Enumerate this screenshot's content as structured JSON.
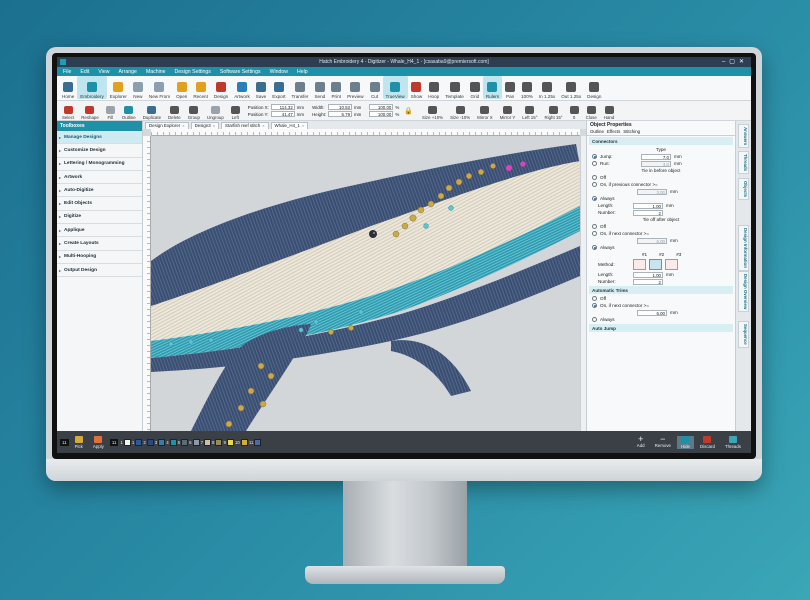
{
  "window": {
    "title": "Hatch Embroidery 4 - Digitizer - Whale_H4_1 - [csasaba9@premiersoft.com]"
  },
  "menu": [
    "File",
    "Edit",
    "View",
    "Arrange",
    "Machine",
    "Design Settings",
    "Software Settings",
    "Window",
    "Help"
  ],
  "ribbon": [
    {
      "label": "Home",
      "icon": "home-icon",
      "color": "#3a6d90"
    },
    {
      "label": "Embroidery",
      "icon": "embroidery-icon",
      "color": "#1e90a8"
    },
    {
      "label": "Explorer",
      "icon": "folder-icon",
      "color": "#e0a21e"
    },
    {
      "label": "New",
      "icon": "new-file-icon",
      "color": "#8aa0b0"
    },
    {
      "label": "New From",
      "icon": "new-from-icon",
      "color": "#8aa0b0"
    },
    {
      "label": "Open",
      "icon": "open-folder-icon",
      "color": "#e0a21e"
    },
    {
      "label": "Recent",
      "icon": "recent-icon",
      "color": "#e0a21e"
    },
    {
      "label": "Design",
      "icon": "design-icon",
      "color": "#c0392b"
    },
    {
      "label": "Artwork",
      "icon": "artwork-icon",
      "color": "#2980b9"
    },
    {
      "label": "Save",
      "icon": "save-icon",
      "color": "#3a6d90"
    },
    {
      "label": "Export",
      "icon": "export-icon",
      "color": "#3a6d90"
    },
    {
      "label": "Transfer",
      "icon": "transfer-icon",
      "color": "#6d7f8c"
    },
    {
      "label": "Send",
      "icon": "send-icon",
      "color": "#6d7f8c"
    },
    {
      "label": "Print",
      "icon": "print-icon",
      "color": "#6d7f8c"
    },
    {
      "label": "Preview",
      "icon": "preview-icon",
      "color": "#6d7f8c"
    },
    {
      "label": "Cut",
      "icon": "cut-icon",
      "color": "#6d7f8c"
    },
    {
      "label": "TrueView",
      "icon": "trueview-icon",
      "color": "#1e90a8"
    },
    {
      "label": "Show",
      "icon": "show-icon",
      "color": "#c0392b"
    },
    {
      "label": "Hoop",
      "icon": "hoop-icon",
      "color": "#555555"
    },
    {
      "label": "Template",
      "icon": "template-icon",
      "color": "#555555"
    },
    {
      "label": "Grid",
      "icon": "grid-icon",
      "color": "#555555"
    },
    {
      "label": "Rulers",
      "icon": "rulers-icon",
      "color": "#1e90a8"
    },
    {
      "label": "Pan",
      "icon": "pan-icon",
      "color": "#555555"
    },
    {
      "label": "100%",
      "icon": "zoom-100-icon",
      "color": "#555555"
    },
    {
      "label": "In 1.25x",
      "icon": "zoom-in-icon",
      "color": "#555555"
    },
    {
      "label": "Out 1.25x",
      "icon": "zoom-out-icon",
      "color": "#555555"
    },
    {
      "label": "Design",
      "icon": "zoom-design-icon",
      "color": "#555555"
    }
  ],
  "toolbar": {
    "tools": [
      {
        "label": "Select",
        "icon": "select-arrow-icon",
        "color": "#c0392b"
      },
      {
        "label": "Reshape",
        "icon": "reshape-icon",
        "color": "#c0392b"
      },
      {
        "label": "Fill",
        "icon": "fill-icon",
        "color": "#9aa3aa"
      },
      {
        "label": "Outline",
        "icon": "outline-icon",
        "color": "#1e90a8"
      },
      {
        "label": "Duplicate",
        "icon": "duplicate-icon",
        "color": "#3a6d90"
      },
      {
        "label": "Delete",
        "icon": "delete-icon",
        "color": "#555555"
      },
      {
        "label": "Group",
        "icon": "group-icon",
        "color": "#555555"
      },
      {
        "label": "Ungroup",
        "icon": "ungroup-icon",
        "color": "#9aa3aa"
      },
      {
        "label": "Left",
        "icon": "align-left-icon",
        "color": "#555555"
      }
    ],
    "position_x_label": "Position X:",
    "position_x": "114.32",
    "position_y_label": "Position Y:",
    "position_y": "41.47",
    "width_label": "Width:",
    "width": "10.53",
    "height_label": "Height:",
    "height": "5.79",
    "unit": "mm",
    "percent_w": "100.00",
    "percent_h": "100.00",
    "percent_unit": "%",
    "right_tools": [
      {
        "label": "Size +10%",
        "icon": "size-plus-icon",
        "color": "#555555"
      },
      {
        "label": "Size -10%",
        "icon": "size-minus-icon",
        "color": "#555555"
      },
      {
        "label": "Mirror X",
        "icon": "mirror-x-icon",
        "color": "#555555"
      },
      {
        "label": "Mirror Y",
        "icon": "mirror-y-icon",
        "color": "#555555"
      },
      {
        "label": "Left 15°",
        "icon": "rotate-left-icon",
        "color": "#555555"
      },
      {
        "label": "Right 15°",
        "icon": "rotate-right-icon",
        "color": "#555555"
      },
      {
        "label": "0",
        "icon": "angle-icon",
        "color": "#555555"
      },
      {
        "label": "Close",
        "icon": "close-shape-icon",
        "color": "#555555"
      },
      {
        "label": "Hand",
        "icon": "hand-icon",
        "color": "#555555"
      }
    ]
  },
  "toolboxes": {
    "title": "Toolboxes",
    "items": [
      "Manage Designs",
      "Customize Design",
      "Lettering / Monogramming",
      "Artwork",
      "Auto-Digitize",
      "Edit Objects",
      "Digitize",
      "Applique",
      "Create Layouts",
      "Multi-Hooping",
      "Output Design"
    ]
  },
  "doc_tabs": [
    "Design Explorer",
    "Design3",
    "Starfish reef stitch",
    "Whale_H4_1"
  ],
  "properties": {
    "title": "Object Properties",
    "tabs": [
      "Outline",
      "Effects",
      "Stitching"
    ],
    "connectors_title": "Connectors",
    "type_label": "Type",
    "jump_label": "Jump:",
    "jump_value": "7.0",
    "run_label": "Run:",
    "run_value": "3.0",
    "unit": "mm",
    "tie_in_title": "Tie in before object",
    "tie_in_off": "Off",
    "tie_in_prev": "On, if previous connector >=",
    "tie_in_prev_value": "3.00",
    "tie_in_always": "Always",
    "length_label": "Length:",
    "length_value": "1.00",
    "number_label": "Number:",
    "number_value": "2",
    "tie_off_title": "Tie off after object",
    "tie_off_off": "Off",
    "tie_off_next": "On, if next connector >=",
    "tie_off_next_value": "6.00",
    "tie_off_always": "Always",
    "method_label": "Method:",
    "method_1": "#1",
    "method_2": "#2",
    "method_3": "#3",
    "length2_value": "1.00",
    "number2_value": "2",
    "trims_title": "Automatic Trims",
    "trims_off": "Off",
    "trims_next": "On, if next connector >=",
    "trims_next_value": "6.00",
    "trims_always": "Always",
    "autojump_title": "Auto Jump"
  },
  "side_tabs": [
    "Answers",
    "Threads",
    "Objects",
    "Design Information",
    "Design Overview",
    "Sequence"
  ],
  "statusbar": {
    "thread_count": "11",
    "pick_label": "Pick",
    "apply_label": "Apply",
    "thread_badge": "11",
    "palette": [
      {
        "num": "1",
        "color": "#f5f5f0"
      },
      {
        "num": "1",
        "color": "#2a5a9a"
      },
      {
        "num": "2",
        "color": "#2a4a7a"
      },
      {
        "num": "3",
        "color": "#3a7ab0"
      },
      {
        "num": "4",
        "color": "#1e90a8"
      },
      {
        "num": "5",
        "color": "#5a6b7a"
      },
      {
        "num": "6",
        "color": "#8a9aa8"
      },
      {
        "num": "7",
        "color": "#c8c0a8"
      },
      {
        "num": "8",
        "color": "#9a8a5a"
      },
      {
        "num": "9",
        "color": "#e8d84a"
      },
      {
        "num": "10",
        "color": "#d4aa3a"
      },
      {
        "num": "11",
        "color": "#4a6aa8"
      }
    ],
    "add_label": "Add",
    "remove_label": "Remove",
    "hide_label": "Hide",
    "discard_label": "Discard",
    "threads_label": "Threads"
  }
}
